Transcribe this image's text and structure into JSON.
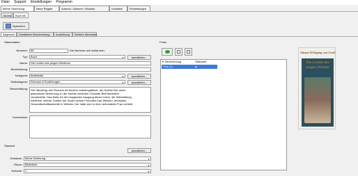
{
  "menu": [
    "Datei",
    "Support",
    "Einstellungen",
    "Programm"
  ],
  "top_tabs": [
    "Meine Sammlung",
    "Neue Regale",
    "Autoren / Akteure / Musiker",
    "Kontakte",
    "Einstellungen"
  ],
  "doc_tabs": [
    "Journal",
    "Buch 68"
  ],
  "toolbar": {
    "save_label": "Speichern"
  },
  "detail_tabs": [
    "Allgemein",
    "Detaillierte Beschreibung",
    "Ausleihung",
    "Weitere Merkmale"
  ],
  "stammdaten": {
    "section_title": "Stammdaten",
    "nummer_label": "Nummer:",
    "nummer_value": "68",
    "nummer_hint": "Die Nummer soll unikal sein.",
    "typ_label": "Typ:",
    "typ_value": "Buch",
    "typ_button": "auswählen...",
    "name_label": "Name:",
    "name_value": "Die Leiden des jungen Werthers",
    "bezeichnung_label": "Bezeichnung:",
    "bezeichnung_value": "",
    "kategorie_label": "Kategorie:",
    "kategorie_value": "Belletristik",
    "kategorie_button": "auswählen...",
    "subkategorie_label": "Subkategorie:",
    "subkategorie_value": "Romane & Erzählungen",
    "subkategorie_button": "auswählen...",
    "beschreibung_label": "Beschreibung:",
    "beschreibung_lines": [
      "Die Handlung des Romans ist insofern autobiografisch, als Goethe hier seine",
      "platonische Beziehung zu der bereits verlobten Charlotte Buff literarisch",
      "verarbeitete. Das Motiv für den tragischen Ausgang dieser Liebe, die Selbsttötung",
      "Werthers, lieferte Goethe der Suizid seines Freundes Karl Wilhelm Jerusalem,",
      "Gesandtschaftssekretär in Wetzlar. Der hatte sich in eine verheiratete Frau verliebt."
    ],
    "kommentar_label": "Kommentar:"
  },
  "standort": {
    "section_title": "Standort",
    "button": "auswählen...",
    "gebaeude_label": "Gebäude:",
    "gebaeude_value": "Meine Wohnung",
    "raum_label": "Raum:",
    "raum_value": "Bibliothek",
    "schrank_label": "Schrank:",
    "schrank_value": "1"
  },
  "fotos": {
    "section_title": "Fotos",
    "col_bezeichnung": "Bezeichnung",
    "col_standard": "Standard",
    "rows": [
      {
        "bezeichnung": "Foto (1)",
        "standard": "ja"
      }
    ]
  },
  "cover": {
    "author": "Johann Wolfgang von Goethe",
    "title_line1": "Die Leiden des",
    "title_line2": "jungen Werther"
  },
  "colors": {
    "selection": "#3b78d8",
    "cover_bg": "#2a4f5e",
    "cover_title": "#d98a3a"
  }
}
